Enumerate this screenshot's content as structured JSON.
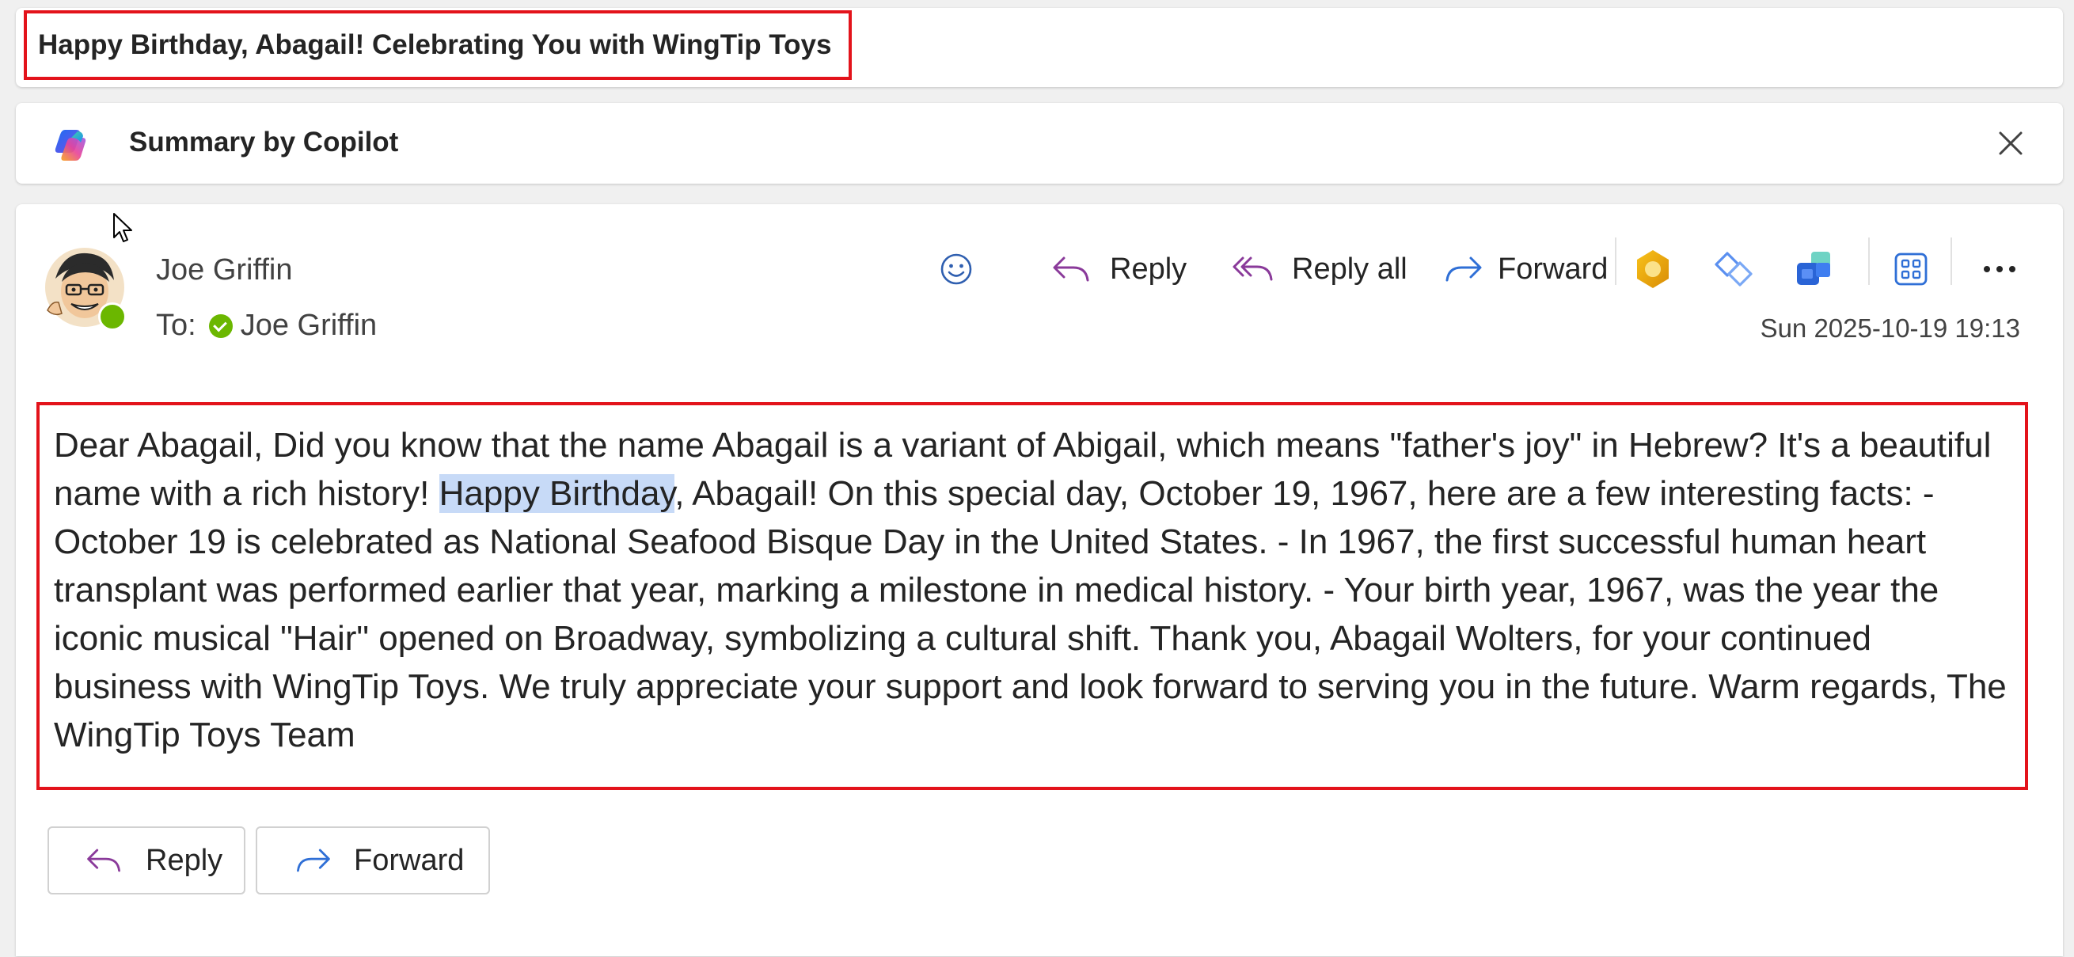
{
  "subject": "Happy Birthday, Abagail! Celebrating You with WingTip Toys",
  "summary": {
    "label": "Summary by Copilot",
    "close_icon": "close-icon"
  },
  "message": {
    "sender": "Joe Griffin",
    "to_label": "To:",
    "to_name": "Joe Griffin",
    "timestamp": "Sun 2025-10-19 19:13",
    "toolbar": {
      "reply": "Reply",
      "reply_all": "Reply all",
      "forward": "Forward",
      "icons": [
        "smiley-icon",
        "reply-icon",
        "reply-all-icon",
        "forward-icon",
        "premium-addin-icon",
        "loop-icon",
        "teams-icon",
        "apps-icon",
        "more-icon"
      ]
    },
    "body": {
      "part1": "Dear Abagail, Did you know that the name Abagail is a variant of Abigail, which means \"father's joy\" in Hebrew? It's a beautiful name with a rich history! ",
      "highlight": "Happy Birthday",
      "part2": ", Abagail! On this special day, October 19, 1967, here are a few interesting facts: - October 19 is celebrated as National Seafood Bisque Day in the United States. - In 1967, the first successful human heart transplant was performed earlier that year, marking a milestone in medical history. - Your birth year, 1967, was the year the iconic musical \"Hair\" opened on Broadway, symbolizing a cultural shift. Thank you, Abagail Wolters, for your continued business with WingTip Toys. We truly appreciate your support and look forward to serving you in the future. Warm regards, The WingTip Toys Team"
    },
    "footer": {
      "reply": "Reply",
      "forward": "Forward"
    }
  },
  "colors": {
    "annotation_box": "#e3131b",
    "highlight": "#c7daf7",
    "presence": "#6bb700",
    "reply_icon": "#8a3a9a",
    "forward_icon": "#2f6fd6"
  }
}
